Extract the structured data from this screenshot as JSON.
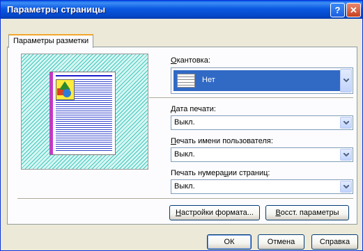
{
  "window": {
    "title": "Параметры страницы",
    "help_label": "?",
    "close_label": "✕"
  },
  "tab": {
    "label": "Параметры разметки"
  },
  "binding": {
    "label_accel": "О",
    "label_rest": "кантовка:",
    "value": "Нет"
  },
  "print_date": {
    "label_accel": "Д",
    "label_rest": "ата печати:",
    "value": "Выкл."
  },
  "print_user": {
    "label_accel": "П",
    "label_rest": "ечать имени пользователя:",
    "value": "Выкл."
  },
  "print_page_num": {
    "label_pre": "Печать нумера",
    "label_accel": "ц",
    "label_post": "ии страниц:",
    "value": "Выкл."
  },
  "buttons": {
    "format_accel": "Н",
    "format_rest": "астройки формата...",
    "restore_accel": "В",
    "restore_rest": "осст. параметры",
    "ok": "ОК",
    "cancel": "Отмена",
    "help": "Справка"
  },
  "colors": {
    "titlebar": "#0a58e0",
    "selection": "#316ac5",
    "tab_accent": "#f3a52a"
  }
}
